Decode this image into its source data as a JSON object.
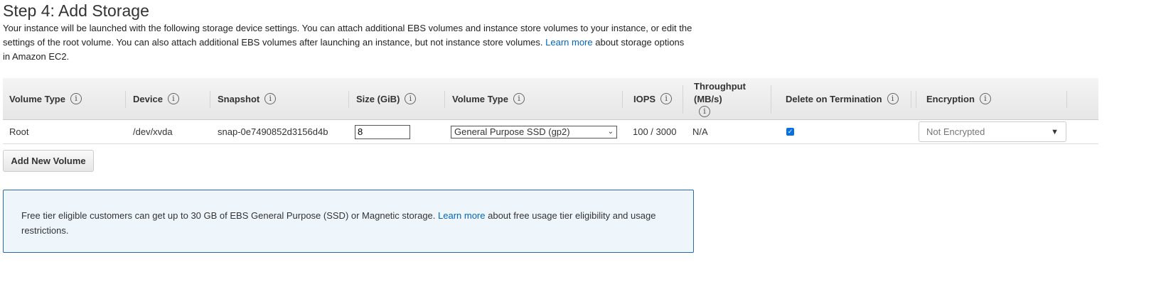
{
  "title": "Step 4: Add Storage",
  "desc": {
    "text1": "Your instance will be launched with the following storage device settings. You can attach additional EBS volumes and instance store volumes to your instance, or edit the settings of the root volume. You can also attach additional EBS volumes after launching an instance, but not instance store volumes. ",
    "link": "Learn more",
    "text2": " about storage options in Amazon EC2."
  },
  "columns": [
    "Volume Type",
    "Device",
    "Snapshot",
    "Size (GiB)",
    "Volume Type",
    "IOPS",
    "Throughput (MB/s)",
    "Delete on Termination",
    "Encryption"
  ],
  "info_glyph": "i",
  "row": {
    "type": "Root",
    "device": "/dev/xvda",
    "snapshot": "snap-0e7490852d3156d4b",
    "size": "8",
    "volume_type": "General Purpose SSD (gp2)",
    "iops": "100 / 3000",
    "throughput": "N/A",
    "delete_on_termination": true,
    "encryption": "Not Encrypted"
  },
  "add_button": "Add New Volume",
  "note": {
    "text1": "Free tier eligible customers can get up to 30 GB of EBS General Purpose (SSD) or Magnetic storage. ",
    "link": "Learn more",
    "text2": " about free usage tier eligibility and usage restrictions."
  }
}
